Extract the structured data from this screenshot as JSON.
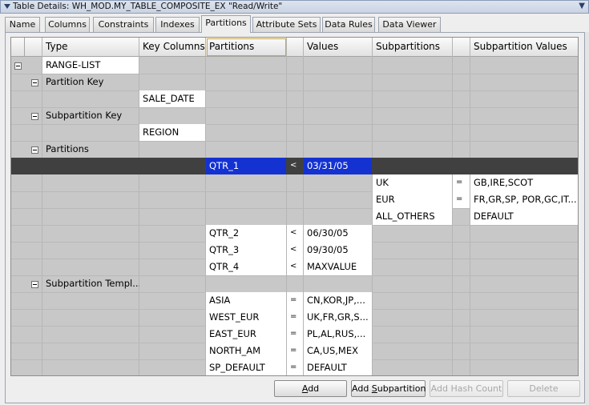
{
  "window": {
    "title": "Table Details: WH_MOD.MY_TABLE_COMPOSITE_EX \"Read/Write\""
  },
  "tabs": [
    "Name",
    "Columns",
    "Constraints",
    "Indexes",
    "Partitions",
    "Attribute Sets",
    "Data Rules",
    "Data Viewer"
  ],
  "active_tab": "Partitions",
  "grid": {
    "headers": [
      "Type",
      "Key Columns",
      "Partitions",
      "Values",
      "Subpartitions",
      "Subpartition Values"
    ],
    "type": "RANGE-LIST",
    "partition_key_label": "Partition Key",
    "partition_key": "SALE_DATE",
    "subpartition_key_label": "Subpartition Key",
    "subpartition_key": "REGION",
    "partitions_label": "Partitions",
    "selected_partition": {
      "name": "QTR_1",
      "op": "<",
      "value": "03/31/05"
    },
    "subpartitions": [
      {
        "name": "UK",
        "op": "=",
        "value": "GB,IRE,SCOT"
      },
      {
        "name": "EUR",
        "op": "=",
        "value": "FR,GR,SP, POR,GC,IT..."
      },
      {
        "name": "ALL_OTHERS",
        "op": "",
        "value": "DEFAULT"
      }
    ],
    "other_partitions": [
      {
        "name": "QTR_2",
        "op": "<",
        "value": "06/30/05"
      },
      {
        "name": "QTR_3",
        "op": "<",
        "value": "09/30/05"
      },
      {
        "name": "QTR_4",
        "op": "<",
        "value": "MAXVALUE"
      }
    ],
    "template_label": "Subpartition Templ...",
    "template": [
      {
        "name": "ASIA",
        "op": "=",
        "value": "CN,KOR,JP,..."
      },
      {
        "name": "WEST_EUR",
        "op": "=",
        "value": "UK,FR,GR,S..."
      },
      {
        "name": "EAST_EUR",
        "op": "=",
        "value": "PL,AL,RUS,..."
      },
      {
        "name": "NORTH_AM",
        "op": "=",
        "value": "CA,US,MEX"
      },
      {
        "name": "SP_DEFAULT",
        "op": "=",
        "value": "DEFAULT"
      }
    ]
  },
  "buttons": {
    "add": {
      "pre": "",
      "ul": "A",
      "post": "dd"
    },
    "add_subpartition": {
      "pre": "Add ",
      "ul": "S",
      "post": "ubpartition"
    },
    "add_hash_count": "Add Hash Count",
    "delete": "Delete"
  }
}
